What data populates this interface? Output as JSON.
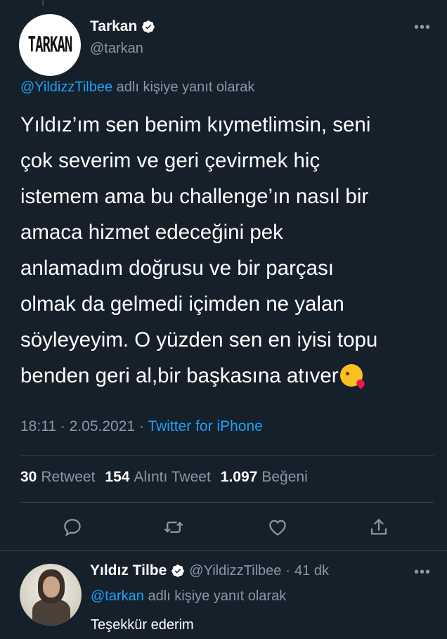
{
  "colors": {
    "background": "#15202b",
    "accent": "#1da1f2",
    "muted": "#8899a6",
    "divider": "#38444d"
  },
  "tweet": {
    "avatar_logo": "TARKAN",
    "display_name": "Tarkan",
    "handle": "@tarkan",
    "verified_icon": "verified-badge-icon",
    "more_icon": "more-options-icon",
    "reply_to": {
      "mention": "@YildizzTilbee",
      "suffix": " adlı kişiye yanıt olarak"
    },
    "text": "Yıldız’ım sen benim kıymetlimsin, seni\nçok severim ve geri çevirmek hiç\nistemem ama bu challenge’ın nasıl bir\namaca hizmet edeceğini pek\nanlamadım doğrusu ve bir parçası\nolmak da gelmedi içimden ne yalan\nsöyleyeyim. O yüzden sen en iyisi topu\nbenden geri al,bir başkasına atıver",
    "emoji": "face-blowing-a-kiss-emoji",
    "time": "18:11",
    "date": "2.05.2021",
    "source": "Twitter for iPhone",
    "stats": {
      "retweets": {
        "count": "30",
        "label": "Retweet"
      },
      "quotes": {
        "count": "154",
        "label": "Alıntı Tweet"
      },
      "likes": {
        "count": "1.097",
        "label": "Beğeni"
      }
    },
    "actions": [
      "reply-icon",
      "retweet-icon",
      "like-icon",
      "share-icon"
    ]
  },
  "reply": {
    "display_name": "Yıldız Tilbe",
    "handle": "@YildizzTilbee",
    "separator": "·",
    "time": "41 dk",
    "reply_to": {
      "mention": "@tarkan",
      "suffix": " adlı kişiye yanıt olarak"
    },
    "text": "Teşekkür ederim"
  }
}
